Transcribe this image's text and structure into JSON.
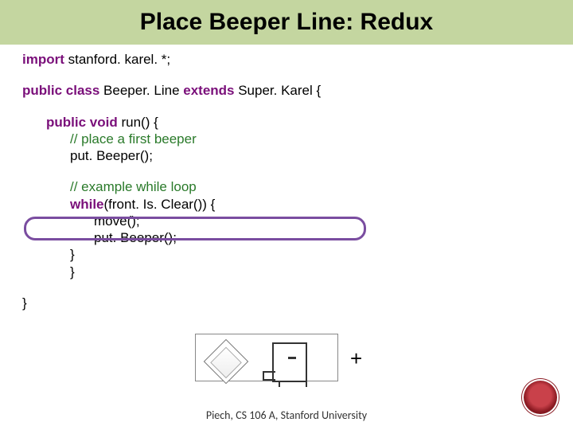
{
  "title": "Place Beeper Line: Redux",
  "code": {
    "l1a": "import",
    "l1b": " stanford. karel. *;",
    "l2a": "public class",
    "l2b": " Beeper. Line ",
    "l2c": "extends",
    "l2d": " Super. Karel {",
    "l3a": "public void",
    "l3b": " run() {",
    "l4": "// place a first beeper",
    "l5": "put. Beeper();",
    "l6": "// example while loop",
    "l7a": "while",
    "l7b": "(front. Is. Clear()) {",
    "l8": "move();",
    "l9": "put. Beeper();",
    "l10": "}",
    "l11": "}",
    "l12": "}"
  },
  "plus": "+",
  "footer": "Piech, CS 106 A, Stanford University"
}
